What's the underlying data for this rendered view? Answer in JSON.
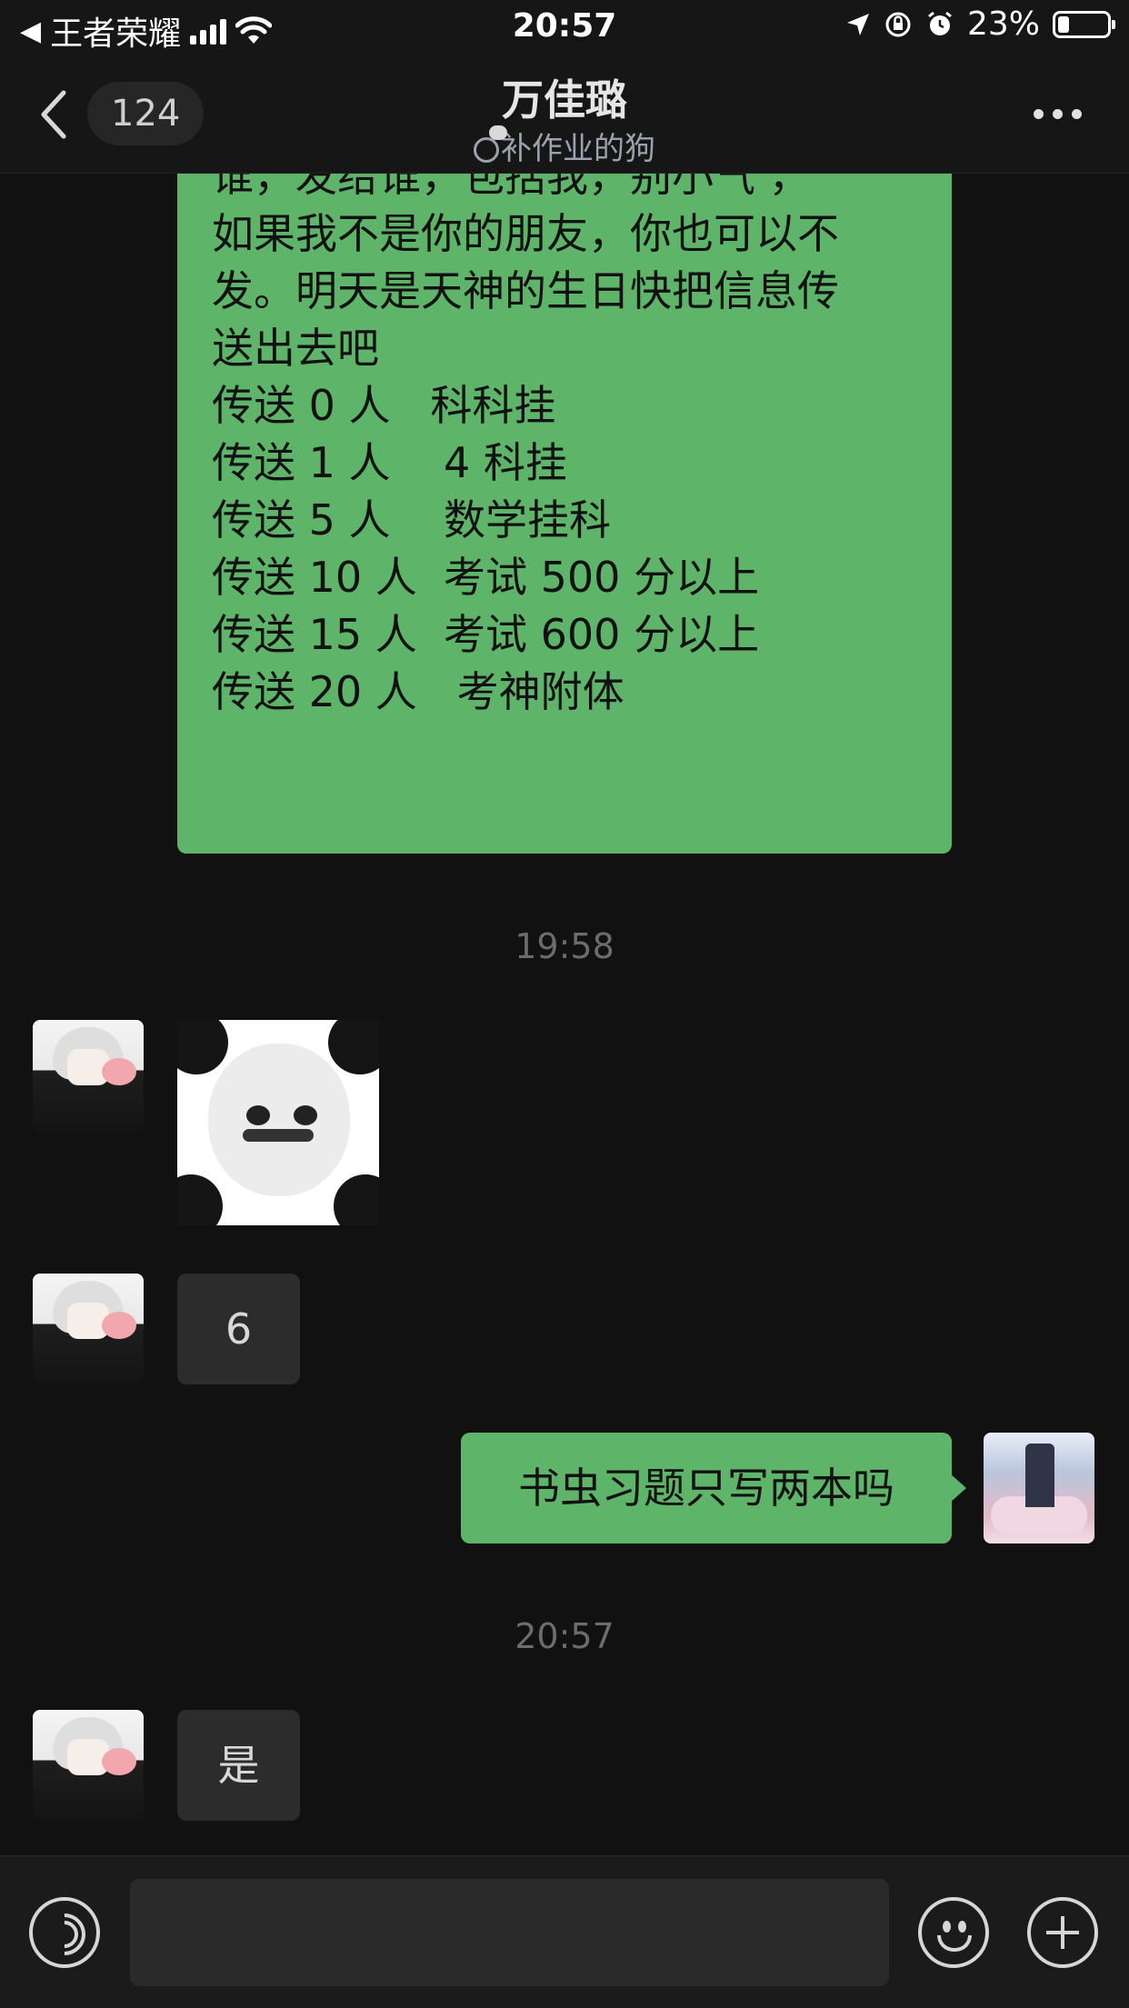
{
  "status_bar": {
    "carrier": "王者荣耀",
    "time": "20:57",
    "battery": "23%"
  },
  "nav": {
    "badge": "124",
    "title": "万佳璐",
    "subtitle": "补作业的狗"
  },
  "messages": {
    "chain_lines": [
      "谁，发给谁，包括我，别小气 ，",
      "如果我不是你的朋友，你也可以不",
      "发。明天是天神的生日快把信息传",
      "送出去吧",
      "",
      "传送 0 人   科科挂",
      "传送 1 人    4 科挂",
      "传送 5 人    数学挂科",
      "传送 10 人  考试 500 分以上",
      "传送 15 人  考试 600 分以上",
      "传送 20 人   考神附体"
    ],
    "time_1": "19:58",
    "reply_six": "6",
    "my_message": "书虫习题只写两本吗",
    "time_2": "20:57",
    "reply_yes": "是"
  },
  "input": {
    "value": ""
  }
}
